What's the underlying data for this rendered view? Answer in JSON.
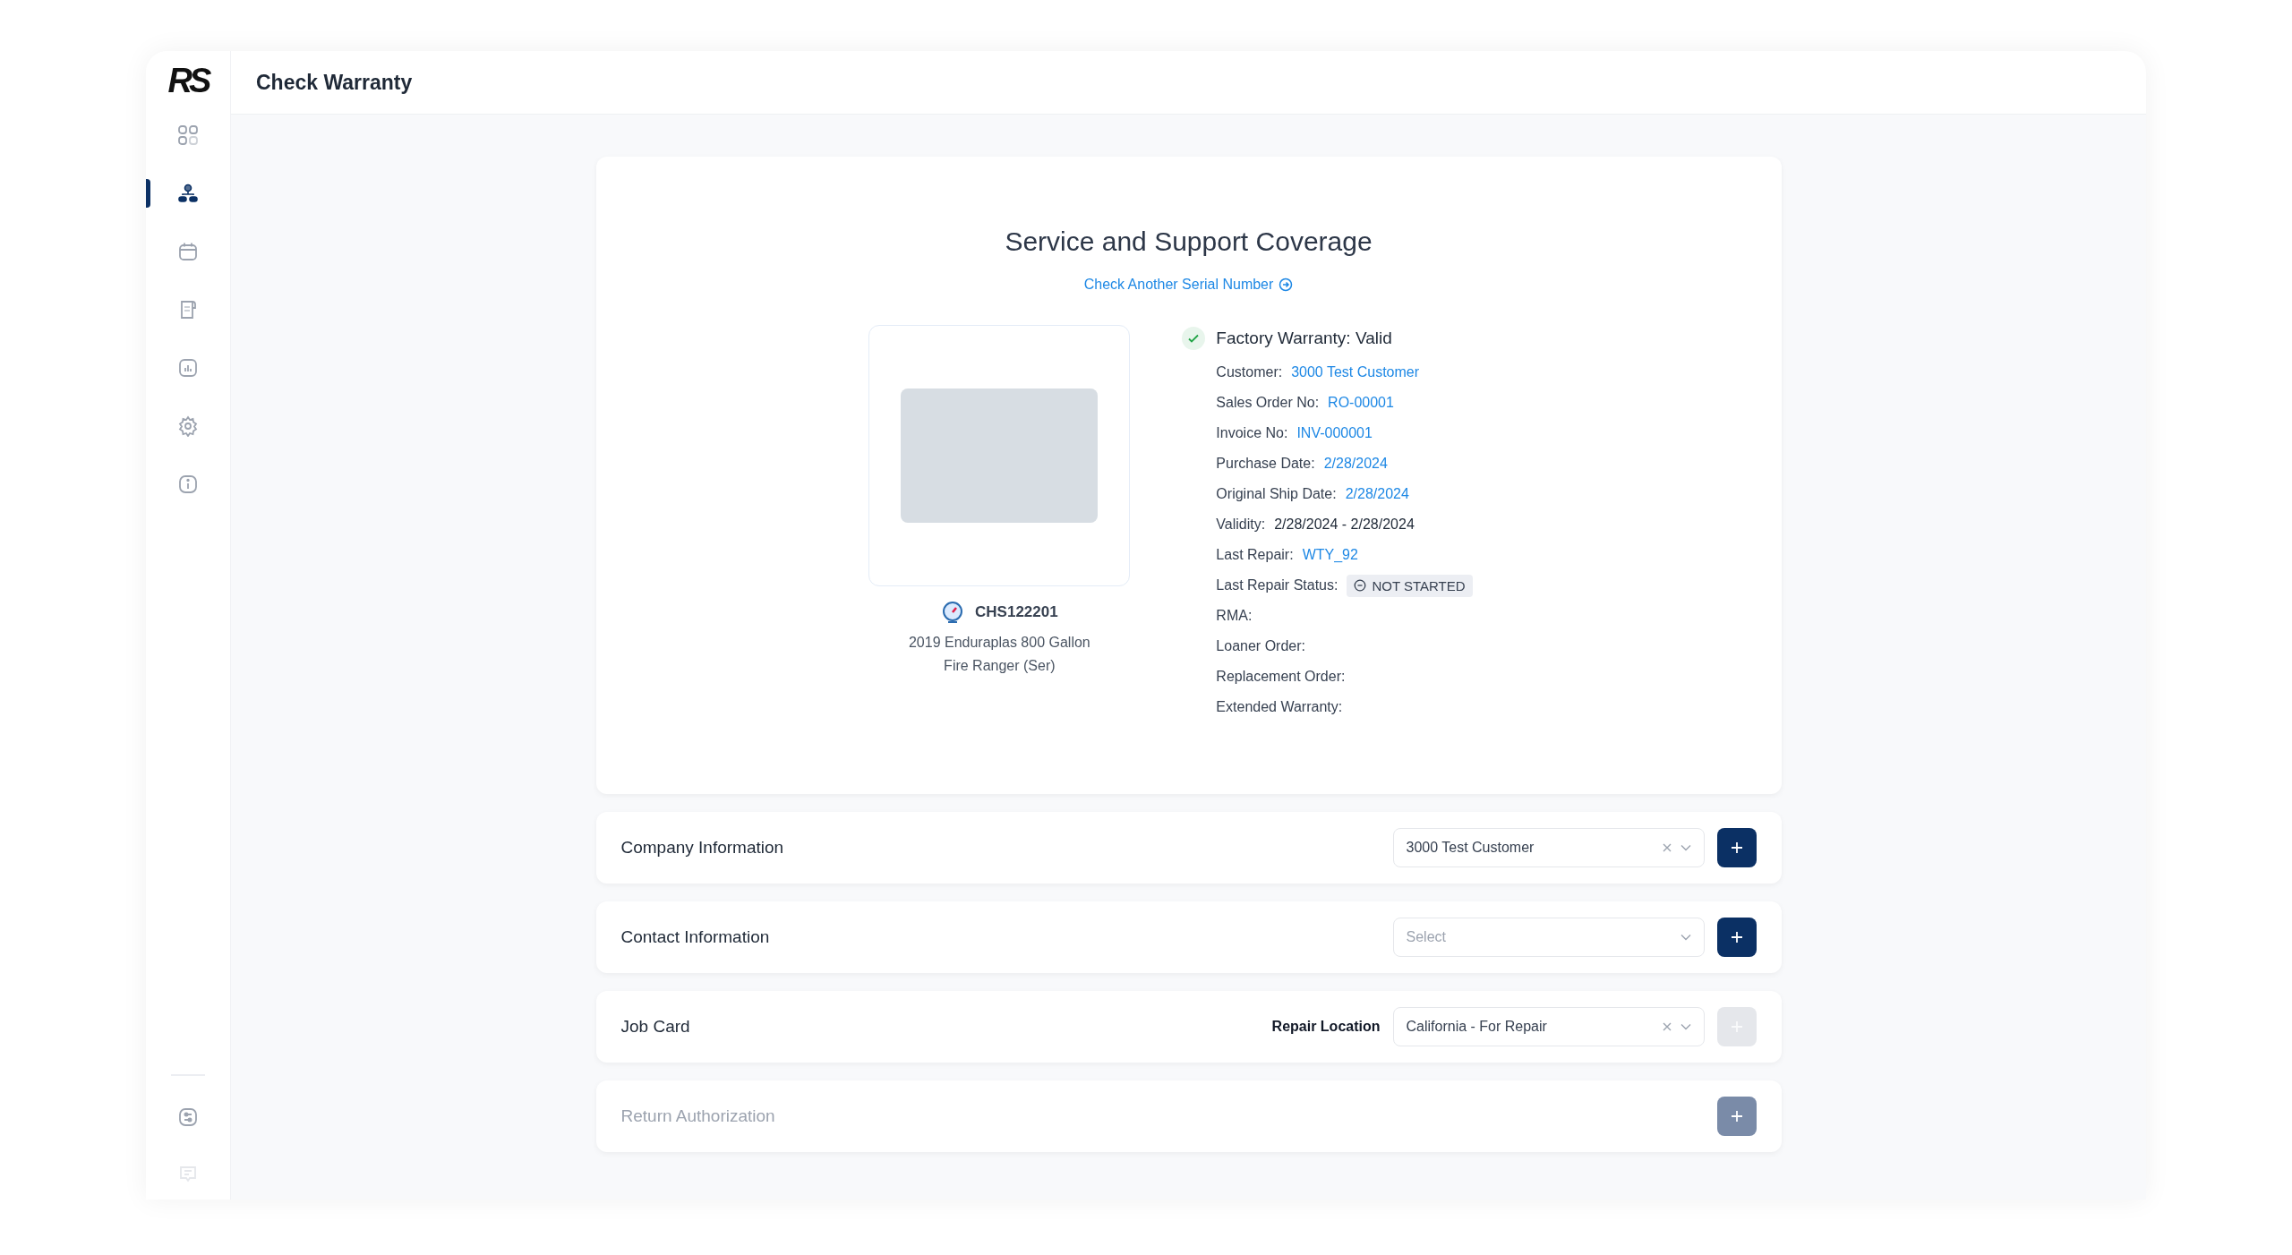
{
  "logo": "RS",
  "header": {
    "title": "Check Warranty"
  },
  "sidebar": {
    "items": [
      {
        "kind": "grid",
        "selected": false
      },
      {
        "kind": "hierarchy",
        "selected": true
      },
      {
        "kind": "calendar",
        "selected": false
      },
      {
        "kind": "document",
        "selected": false
      },
      {
        "kind": "chart",
        "selected": false
      },
      {
        "kind": "gear",
        "selected": false
      },
      {
        "kind": "info",
        "selected": false
      }
    ],
    "bottom_items": [
      {
        "kind": "sliders",
        "selected": false
      },
      {
        "kind": "chat",
        "selected": false
      }
    ]
  },
  "coverage": {
    "title": "Service and Support Coverage",
    "link": "Check Another Serial Number",
    "product": {
      "serial": "CHS122201",
      "description": "2019 Enduraplas 800 Gallon Fire Ranger (Ser)"
    },
    "warranty": {
      "status": "Factory Warranty: Valid",
      "valid": true
    },
    "details": [
      {
        "label": "Customer:",
        "value": "3000 Test Customer",
        "kind": "link"
      },
      {
        "label": "Sales Order No:",
        "value": "RO-00001",
        "kind": "link"
      },
      {
        "label": "Invoice No:",
        "value": "INV-000001",
        "kind": "link"
      },
      {
        "label": "Purchase Date:",
        "value": "2/28/2024",
        "kind": "link"
      },
      {
        "label": "Original Ship Date:",
        "value": "2/28/2024",
        "kind": "link"
      },
      {
        "label": "Validity:",
        "value": "2/28/2024 - 2/28/2024",
        "kind": "text"
      },
      {
        "label": "Last Repair:",
        "value": "WTY_92",
        "kind": "link"
      },
      {
        "label": "Last Repair Status:",
        "value": "NOT STARTED",
        "kind": "status"
      },
      {
        "label": "RMA:",
        "kind": "empty"
      },
      {
        "label": "Loaner Order:",
        "kind": "empty"
      },
      {
        "label": "Replacement Order:",
        "kind": "empty"
      },
      {
        "label": "Extended Warranty:",
        "kind": "empty"
      }
    ]
  },
  "sections": [
    {
      "title": "Company Information",
      "select": {
        "value": "3000 Test Customer",
        "clearable": true
      },
      "add_disabled": false,
      "disabled": false
    },
    {
      "title": "Contact Information",
      "select": {
        "placeholder": "Select",
        "clearable": false
      },
      "add_disabled": false,
      "disabled": false
    },
    {
      "title": "Job Card",
      "label": "Repair Location",
      "select": {
        "value": "California - For Repair",
        "clearable": true
      },
      "add_disabled": true,
      "disabled": false
    },
    {
      "title": "Return Authorization",
      "add_disabled": false,
      "disabled": true
    }
  ]
}
